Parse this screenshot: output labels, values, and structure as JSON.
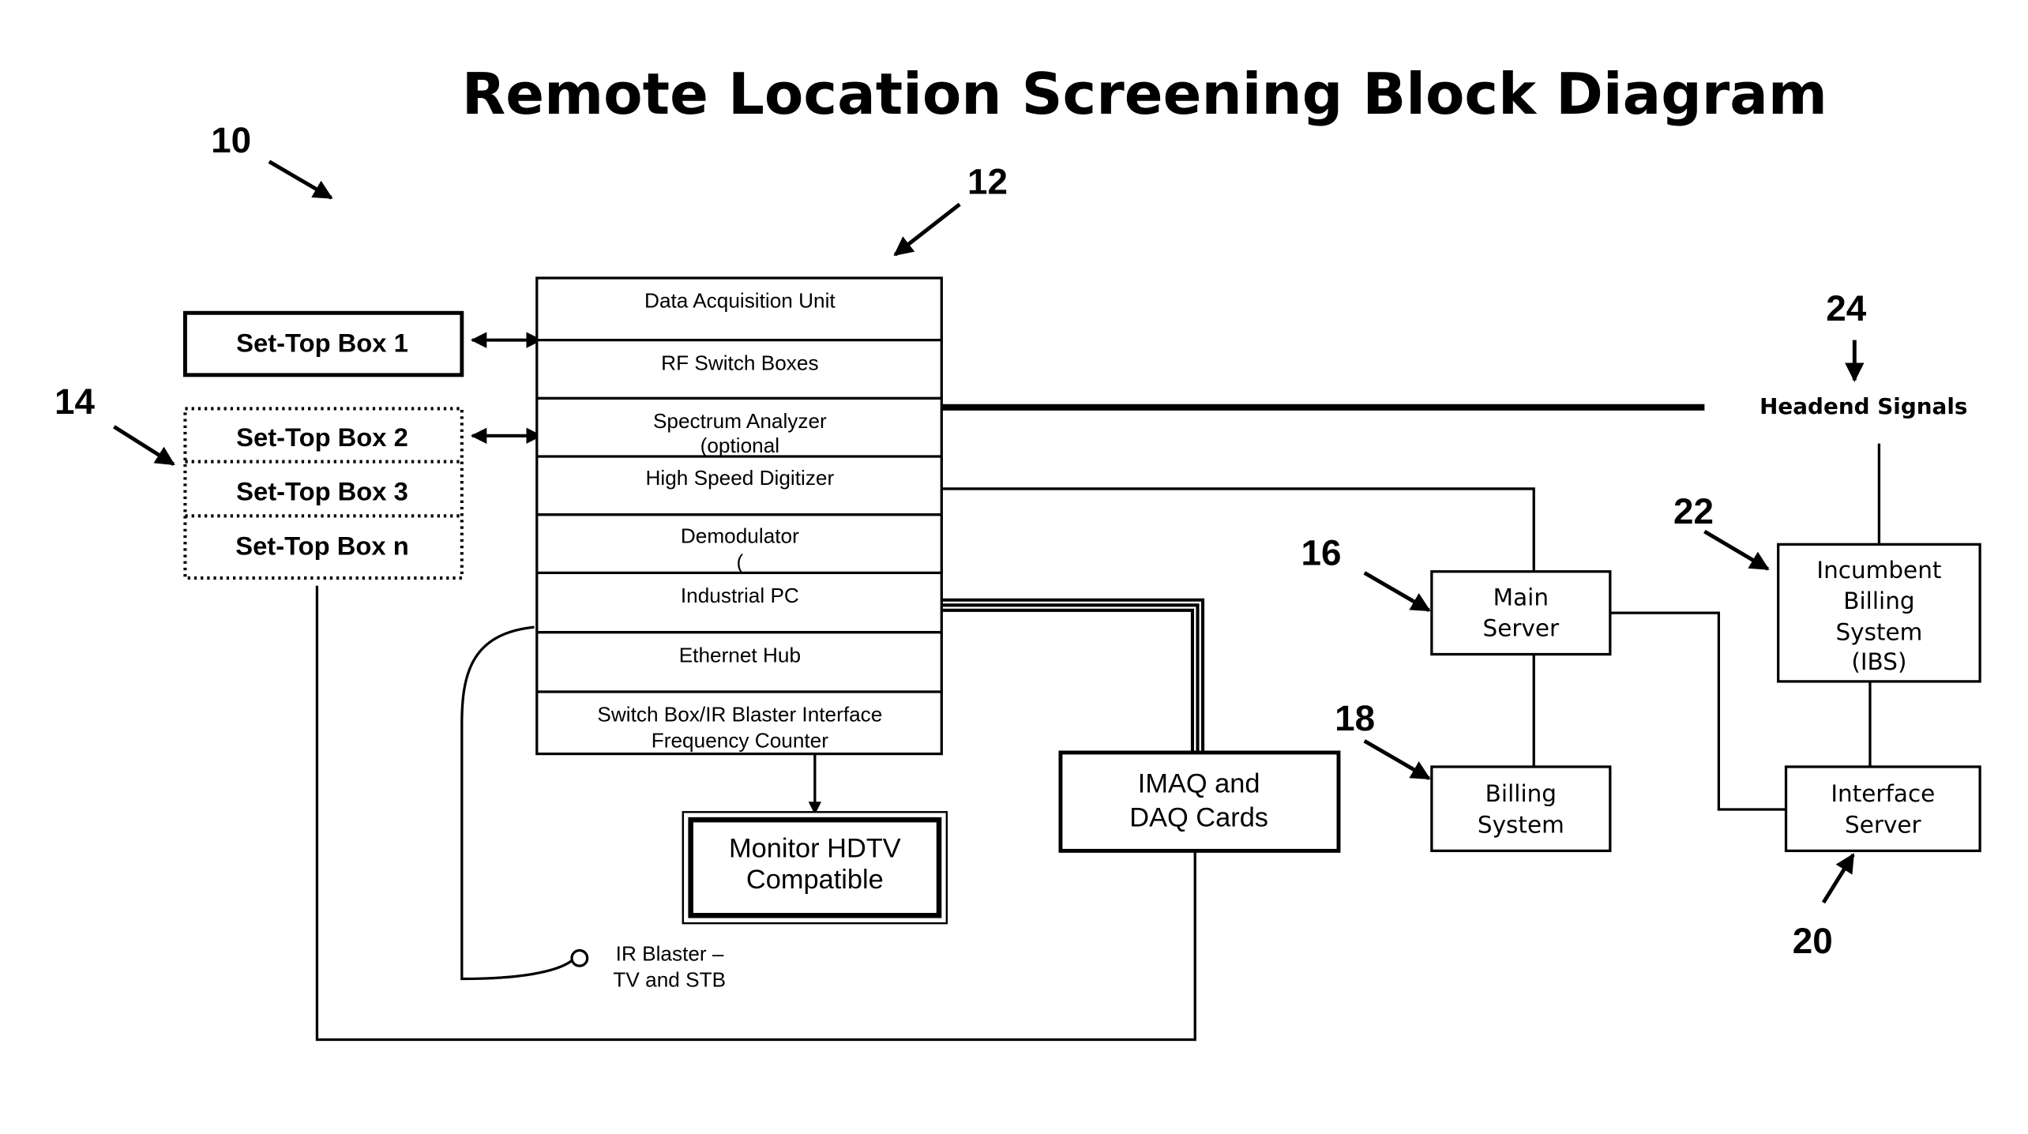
{
  "title": "Remote Location Screening Block Diagram",
  "reference_numerals": {
    "system": "10",
    "data_acquisition": "12",
    "set_top_boxes": "14",
    "main_server": "16",
    "billing_system": "18",
    "interface_server": "20",
    "incumbent_billing": "22",
    "headend": "24"
  },
  "set_top_boxes": [
    "Set-Top Box 1",
    "Set-Top Box 2",
    "Set-Top Box 3",
    "Set-Top Box n"
  ],
  "daq_stack": {
    "cells": [
      {
        "line1": "Data Acquisition Unit",
        "line2": ""
      },
      {
        "line1": "RF Switch Boxes",
        "line2": ""
      },
      {
        "line1": "Spectrum Analyzer",
        "line2": "(optional"
      },
      {
        "line1": "High Speed Digitizer",
        "line2": ""
      },
      {
        "line1": "Demodulator",
        "line2": "("
      },
      {
        "line1": "Industrial PC",
        "line2": ""
      },
      {
        "line1": "Ethernet Hub",
        "line2": ""
      },
      {
        "line1": "Switch Box/IR Blaster Interface",
        "line2": "Frequency Counter"
      }
    ]
  },
  "monitor": {
    "line1": "Monitor HDTV",
    "line2": "Compatible"
  },
  "imaq": {
    "line1": "IMAQ and",
    "line2": "DAQ Cards"
  },
  "ir_blaster": {
    "line1": "IR Blaster –",
    "line2": "TV and STB"
  },
  "main_server": {
    "line1": "Main",
    "line2": "Server"
  },
  "billing_system": {
    "line1": "Billing",
    "line2": "System"
  },
  "interface_server": {
    "line1": "Interface",
    "line2": "Server"
  },
  "incumbent_billing": {
    "line1": "Incumbent",
    "line2": "Billing",
    "line3": "System",
    "line4": "(IBS)"
  },
  "headend": "Headend Signals"
}
